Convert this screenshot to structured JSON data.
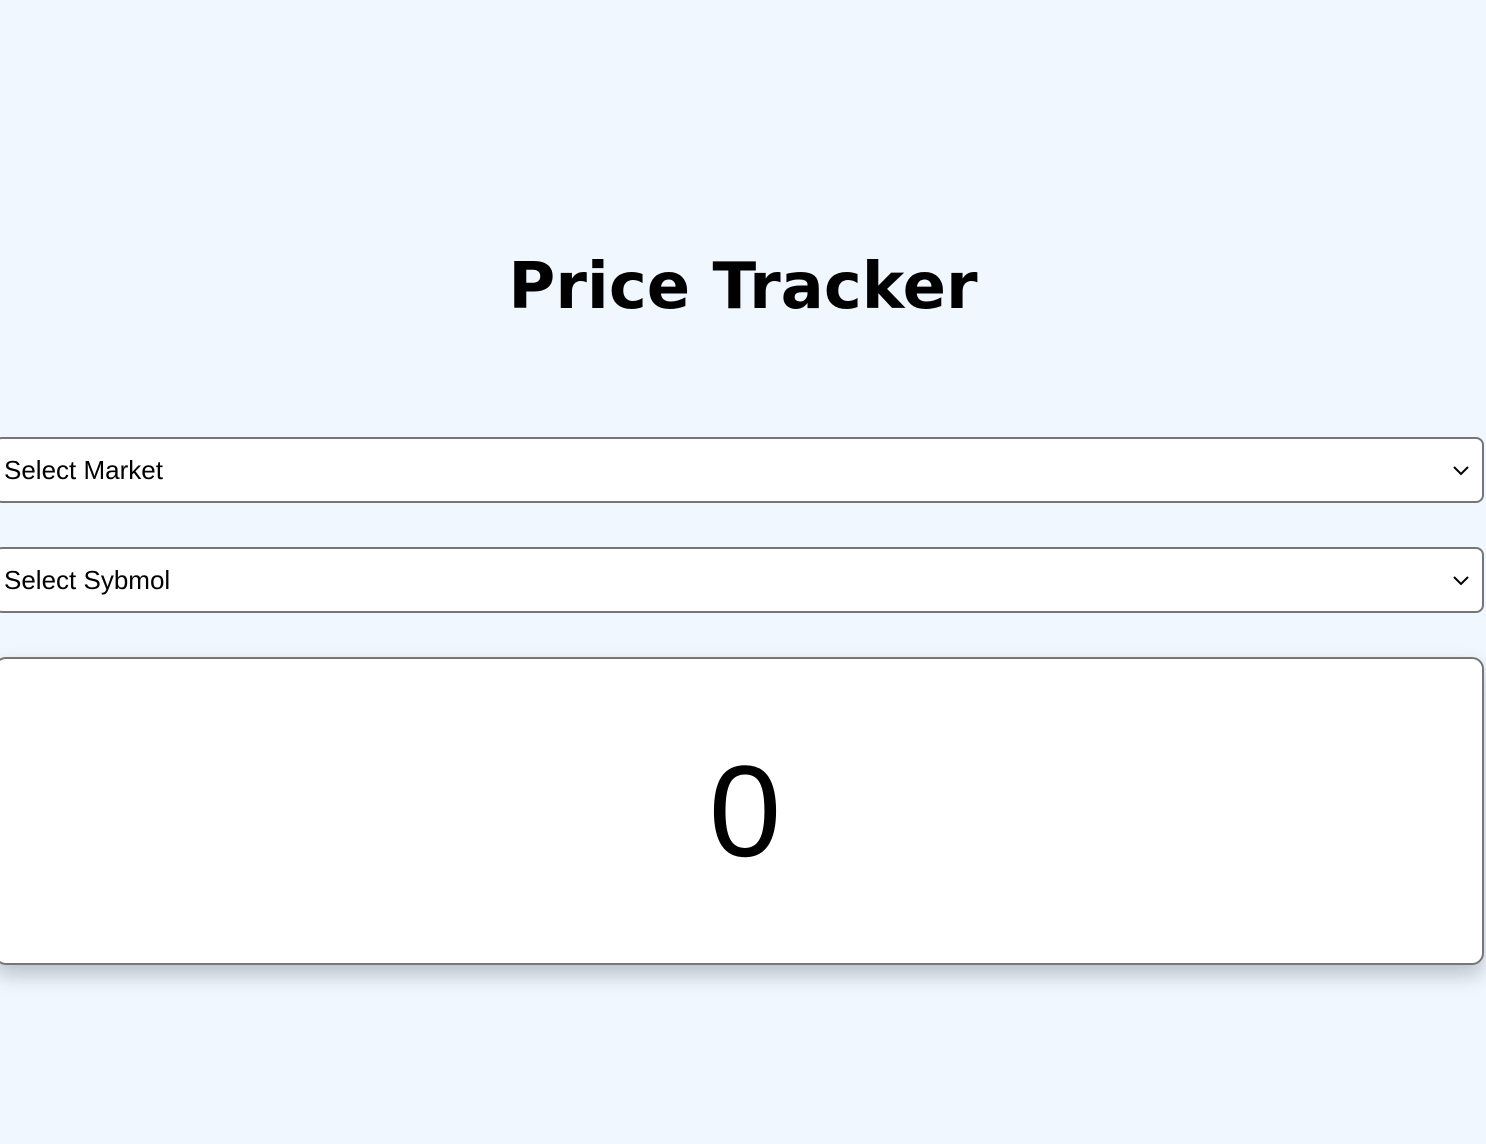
{
  "header": {
    "title": "Price Tracker"
  },
  "market_select": {
    "value": "Select Market",
    "icon": "chevron-down-icon"
  },
  "symbol_select": {
    "value": "Select Sybmol",
    "icon": "chevron-down-icon"
  },
  "price_display": {
    "value": "0"
  },
  "colors": {
    "background": "#f0f7ff",
    "card": "#ffffff",
    "border": "#767676"
  }
}
